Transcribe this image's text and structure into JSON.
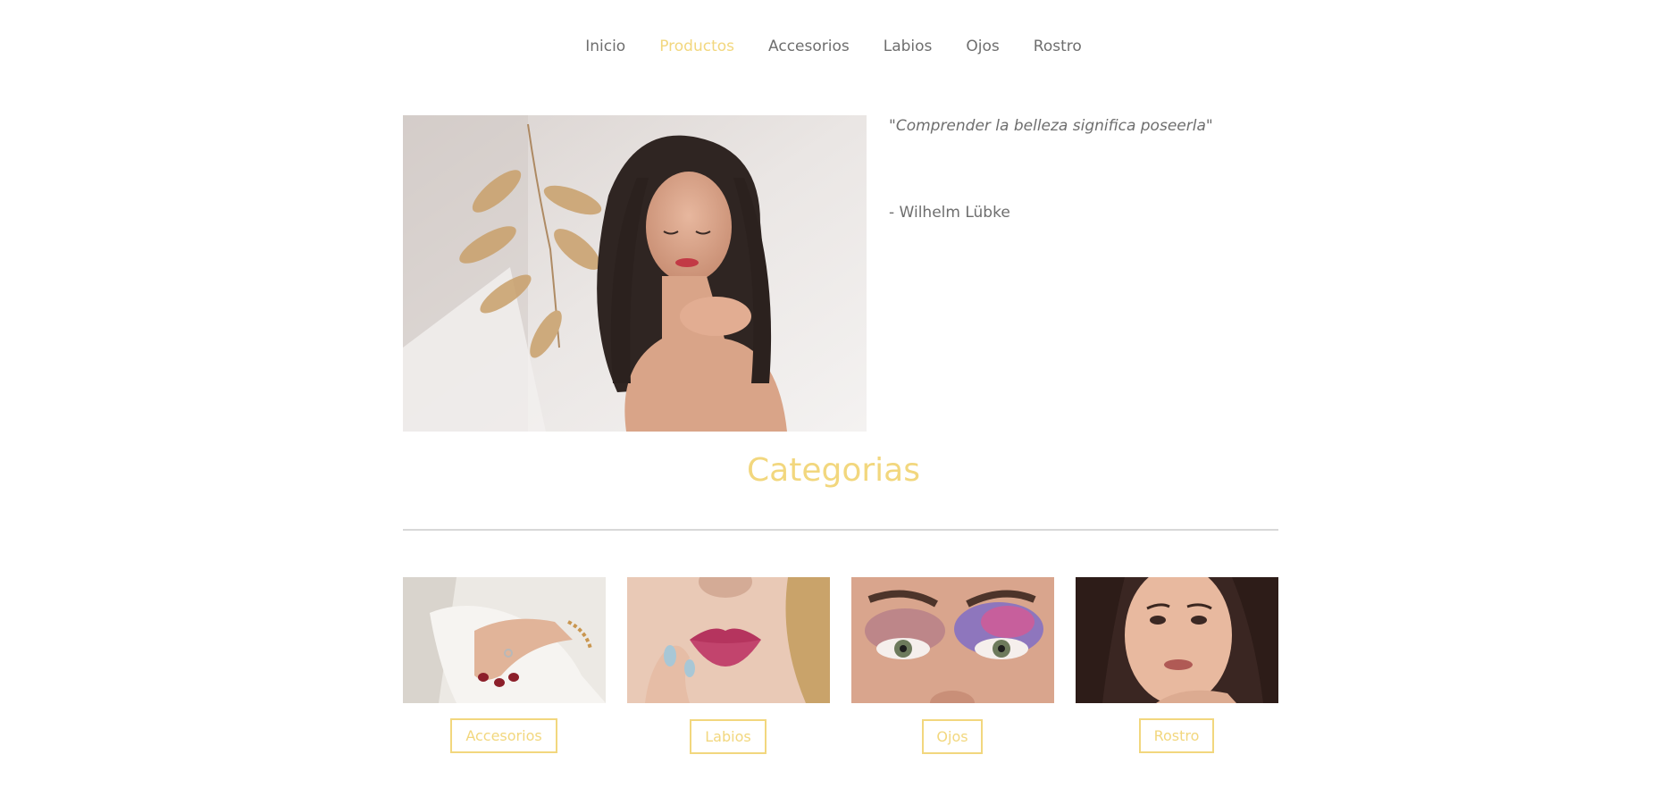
{
  "nav": {
    "items": [
      {
        "label": "Inicio",
        "active": false
      },
      {
        "label": "Productos",
        "active": true
      },
      {
        "label": "Accesorios",
        "active": false
      },
      {
        "label": "Labios",
        "active": false
      },
      {
        "label": "Ojos",
        "active": false
      },
      {
        "label": "Rostro",
        "active": false
      }
    ]
  },
  "hero": {
    "quote": "\"Comprender la belleza significa poseerla\"",
    "author": "- Wilhelm Lübke"
  },
  "categories": {
    "title": "Categorias",
    "items": [
      {
        "label": "Accesorios"
      },
      {
        "label": "Labios"
      },
      {
        "label": "Ojos"
      },
      {
        "label": "Rostro"
      }
    ]
  },
  "colors": {
    "accent": "#f2d77e",
    "text": "#6e6e6e",
    "divider": "#d8d8d8"
  }
}
